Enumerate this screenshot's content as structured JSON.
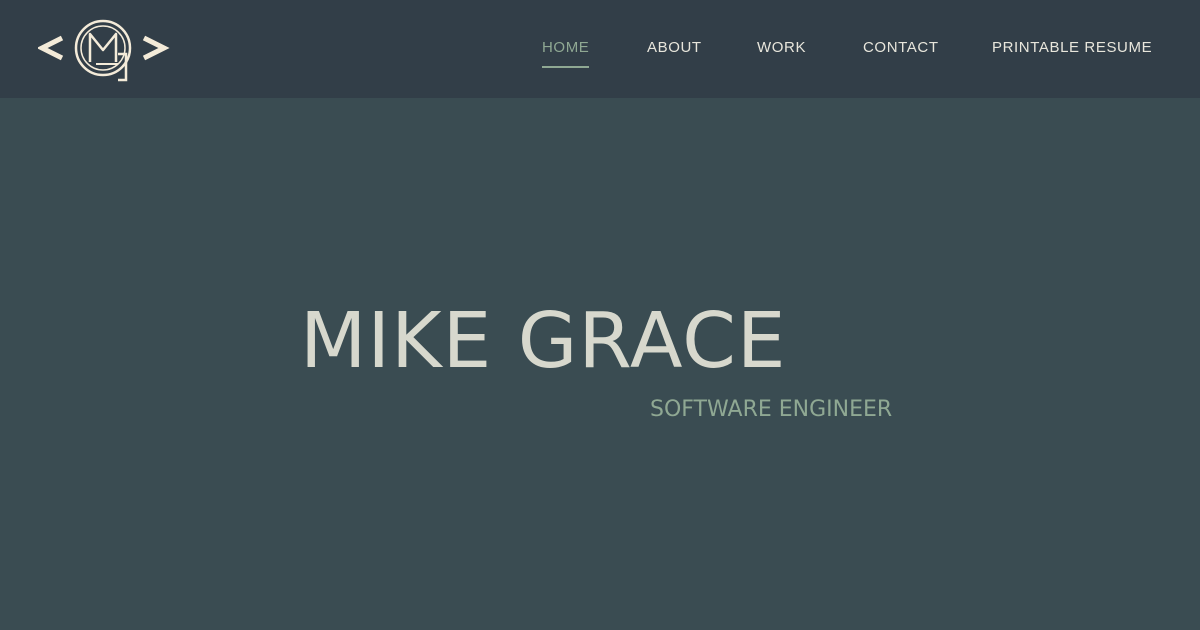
{
  "logo": {
    "icon": "mg-monogram-logo-icon",
    "color": "#f4ebd9"
  },
  "nav": {
    "items": [
      {
        "label": "HOME",
        "active": true
      },
      {
        "label": "ABOUT",
        "active": false
      },
      {
        "label": "WORK",
        "active": false
      },
      {
        "label": "CONTACT",
        "active": false
      },
      {
        "label": "PRINTABLE RESUME",
        "active": false
      }
    ]
  },
  "hero": {
    "name": "MIKE GRACE",
    "role": "SOFTWARE ENGINEER"
  },
  "colors": {
    "header_bg": "#323e48",
    "page_bg": "#3a4c52",
    "accent": "#8fa893",
    "text": "#d7d8cd"
  }
}
